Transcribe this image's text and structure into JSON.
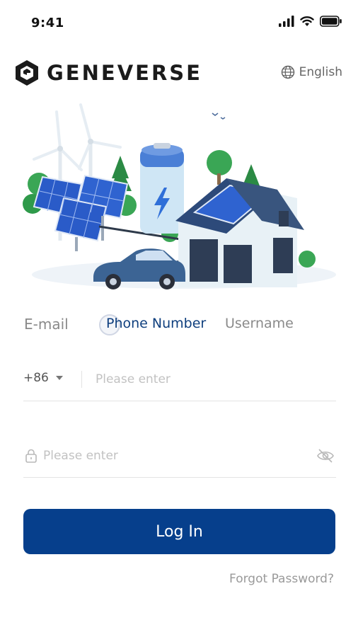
{
  "status_bar": {
    "time": "9:41"
  },
  "header": {
    "brand": "GENEVERSE",
    "language": "English"
  },
  "tabs": {
    "email": "E-mail",
    "phone": "Phone Number",
    "username": "Username"
  },
  "phone_field": {
    "country_code": "+86",
    "placeholder": "Please enter"
  },
  "password_field": {
    "placeholder": "Please enter"
  },
  "login_button": {
    "label": "Log In"
  },
  "forgot_password": {
    "label": "Forgot Password?"
  },
  "colors": {
    "primary": "#063f8c",
    "tab_active": "#0f3f7e"
  }
}
